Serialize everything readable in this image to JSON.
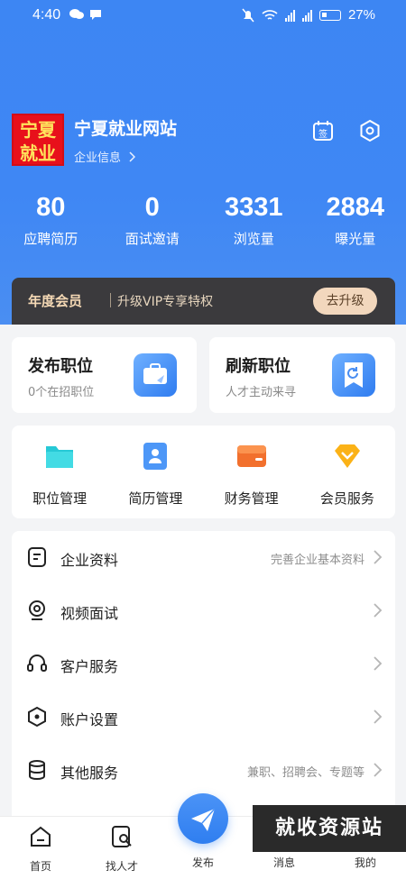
{
  "status_bar": {
    "time": "4:40",
    "net_left": "4G",
    "net_right": "4G",
    "battery": "27%"
  },
  "header": {
    "logo_line1": "宁夏",
    "logo_line2": "就业",
    "company_name": "宁夏就业网站",
    "company_info_link": "企业信息"
  },
  "stats": [
    {
      "value": "80",
      "label": "应聘简历"
    },
    {
      "value": "0",
      "label": "面试邀请"
    },
    {
      "value": "3331",
      "label": "浏览量"
    },
    {
      "value": "2884",
      "label": "曝光量"
    }
  ],
  "vip_banner": {
    "title": "年度会员",
    "subtitle": "升级VIP专享特权",
    "button": "去升级"
  },
  "quick_actions": [
    {
      "title": "发布职位",
      "subtitle": "0个在招职位"
    },
    {
      "title": "刷新职位",
      "subtitle": "人才主动来寻"
    }
  ],
  "grid": [
    {
      "label": "职位管理"
    },
    {
      "label": "简历管理"
    },
    {
      "label": "财务管理"
    },
    {
      "label": "会员服务"
    }
  ],
  "menu": [
    {
      "label": "企业资料",
      "hint": "完善企业基本资料"
    },
    {
      "label": "视频面试",
      "hint": ""
    },
    {
      "label": "客户服务",
      "hint": ""
    },
    {
      "label": "账户设置",
      "hint": ""
    },
    {
      "label": "其他服务",
      "hint": "兼职、招聘会、专题等"
    }
  ],
  "tabbar": [
    {
      "label": "首页"
    },
    {
      "label": "找人才"
    },
    {
      "label": "发布"
    },
    {
      "label": "消息"
    },
    {
      "label": "我的"
    }
  ],
  "watermark": "就收资源站",
  "colors": {
    "brand_blue": "#3d86f3",
    "vip_dark": "#3b3a3d",
    "vip_gold": "#f2d7bd",
    "logo_red": "#e8101b"
  }
}
